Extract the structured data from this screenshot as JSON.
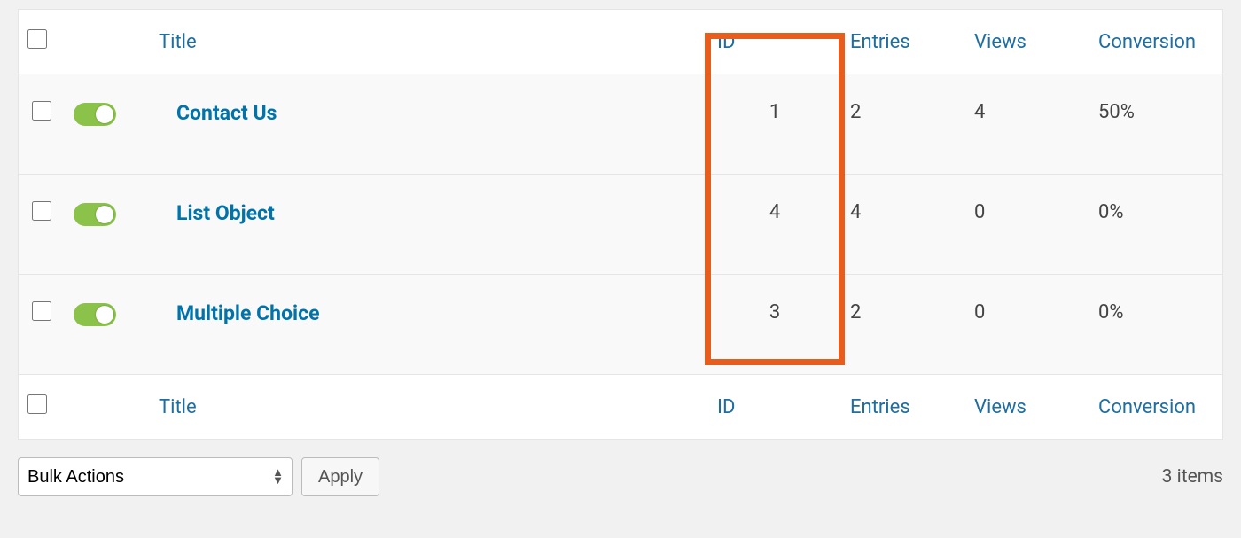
{
  "table": {
    "columns": {
      "title": "Title",
      "id": "ID",
      "entries": "Entries",
      "views": "Views",
      "conversion": "Conversion"
    },
    "rows": [
      {
        "title": "Contact Us",
        "id": "1",
        "entries": "2",
        "views": "4",
        "conversion": "50%",
        "active": true
      },
      {
        "title": "List Object",
        "id": "4",
        "entries": "4",
        "views": "0",
        "conversion": "0%",
        "active": true
      },
      {
        "title": "Multiple Choice",
        "id": "3",
        "entries": "2",
        "views": "0",
        "conversion": "0%",
        "active": true
      }
    ]
  },
  "bulk_actions": {
    "label": "Bulk Actions",
    "apply": "Apply"
  },
  "footer": {
    "item_count": "3 items"
  },
  "highlight": {
    "column": "id"
  }
}
